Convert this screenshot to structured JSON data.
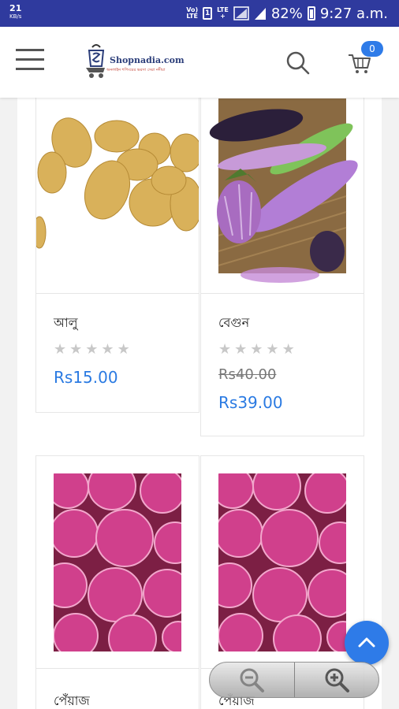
{
  "status_bar": {
    "speed_value": "21",
    "speed_unit": "KB/s",
    "volte": "Vo)\nLTE",
    "sim_label": "1",
    "lte_label": "LTE\n+",
    "battery": "82%",
    "time": "9:27 a.m."
  },
  "header": {
    "logo_name": "Shopnadia.com",
    "logo_tagline": "অনলাইন শপিংয়ের ভরসা সেরা নদীয়া",
    "cart_count": "0"
  },
  "products": [
    {
      "name": "আলু",
      "rating": 0,
      "old_price": "",
      "price": "Rs15.00",
      "image": "potatoes"
    },
    {
      "name": "বেগুন",
      "rating": 0,
      "old_price": "Rs40.00",
      "price": "Rs39.00",
      "image": "eggplants"
    },
    {
      "name": "পেঁয়াজ",
      "rating": 0,
      "old_price": "",
      "price": "",
      "image": "onions"
    },
    {
      "name": "পেঁয়াজ",
      "rating": 0,
      "old_price": "",
      "price": "",
      "image": "onions"
    }
  ],
  "icons": {
    "menu": "hamburger-icon",
    "search": "search-icon",
    "cart": "cart-icon",
    "scroll_top": "chevron-up-icon",
    "zoom_out": "zoom-out-icon",
    "zoom_in": "zoom-in-icon"
  },
  "colors": {
    "status_bar": "#2f3a9e",
    "accent": "#2e7be8",
    "price": "#2a7ae2"
  }
}
